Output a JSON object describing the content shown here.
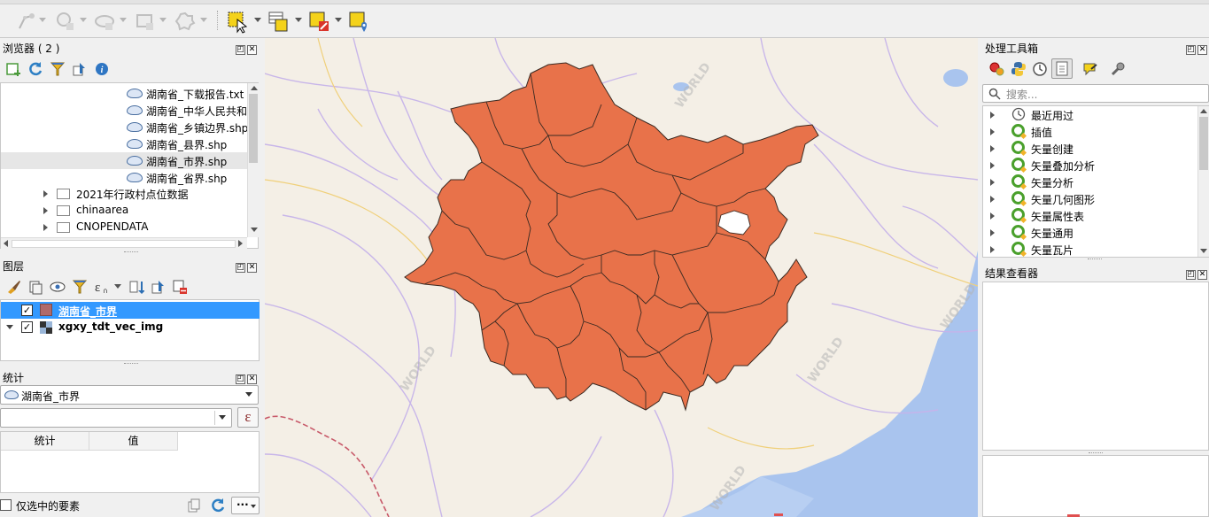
{
  "toolbar": {
    "buttons": [
      {
        "name": "digitize-edit-icon",
        "state": "disabled"
      },
      {
        "name": "select-circle-icon",
        "state": "disabled"
      },
      {
        "name": "identify-cloud-icon",
        "state": "disabled"
      },
      {
        "name": "table-icon",
        "state": "disabled"
      },
      {
        "name": "gear-icon",
        "state": "disabled"
      },
      {
        "name": "select-features-icon",
        "state": "active"
      },
      {
        "name": "select-by-attribute-icon",
        "state": "enabled"
      },
      {
        "name": "deselect-icon",
        "state": "enabled"
      },
      {
        "name": "select-location-icon",
        "state": "enabled"
      }
    ]
  },
  "browser": {
    "title": "浏览器 ( 2 )",
    "toolbar_icons": [
      "add-layer-icon",
      "refresh-icon",
      "filter-icon",
      "collapse-icon",
      "info-icon"
    ],
    "items": [
      {
        "label": "湖南省_下载报告.txt",
        "type": "file",
        "selected": false
      },
      {
        "label": "湖南省_中华人民共和",
        "type": "file",
        "selected": false
      },
      {
        "label": "湖南省_乡镇边界.shp",
        "type": "file",
        "selected": false
      },
      {
        "label": "湖南省_县界.shp",
        "type": "file",
        "selected": false
      },
      {
        "label": "湖南省_市界.shp",
        "type": "file",
        "selected": true
      },
      {
        "label": "湖南省_省界.shp",
        "type": "file",
        "selected": false
      },
      {
        "label": "2021年行政村点位数据",
        "type": "folder",
        "selected": false
      },
      {
        "label": "chinaarea",
        "type": "folder",
        "selected": false
      },
      {
        "label": "CNOPENDATA",
        "type": "folder",
        "selected": false
      }
    ]
  },
  "layers": {
    "title": "图层",
    "toolbar_icons": [
      "style-brush-icon",
      "add-group-icon",
      "eye-icon",
      "filter-icon",
      "expression-icon",
      "expand-icon",
      "collapse-icon",
      "remove-layer-icon"
    ],
    "items": [
      {
        "label": "湖南省_市界",
        "checked": true,
        "selected": true,
        "swatch": "#b06a6a"
      },
      {
        "label": "xgxy_tdt_vec_img",
        "checked": true,
        "selected": false
      }
    ]
  },
  "stats": {
    "title": "统计",
    "layer_value": "湖南省_市界",
    "field_value": "",
    "expression_symbol": "ε",
    "columns": [
      "统计",
      "值"
    ],
    "selected_only_label": "仅选中的要素",
    "more_label": "···"
  },
  "processing": {
    "title": "处理工具箱",
    "search_placeholder": "搜索...",
    "items": [
      "最近用过",
      "插值",
      "矢量创建",
      "矢量叠加分析",
      "矢量分析",
      "矢量几何图形",
      "矢量属性表",
      "矢量通用",
      "矢量瓦片"
    ]
  },
  "results": {
    "title": "结果查看器"
  },
  "map": {
    "watermark": "WORLD",
    "province_color": "#e8724a",
    "hole_color": "#ffffff"
  }
}
